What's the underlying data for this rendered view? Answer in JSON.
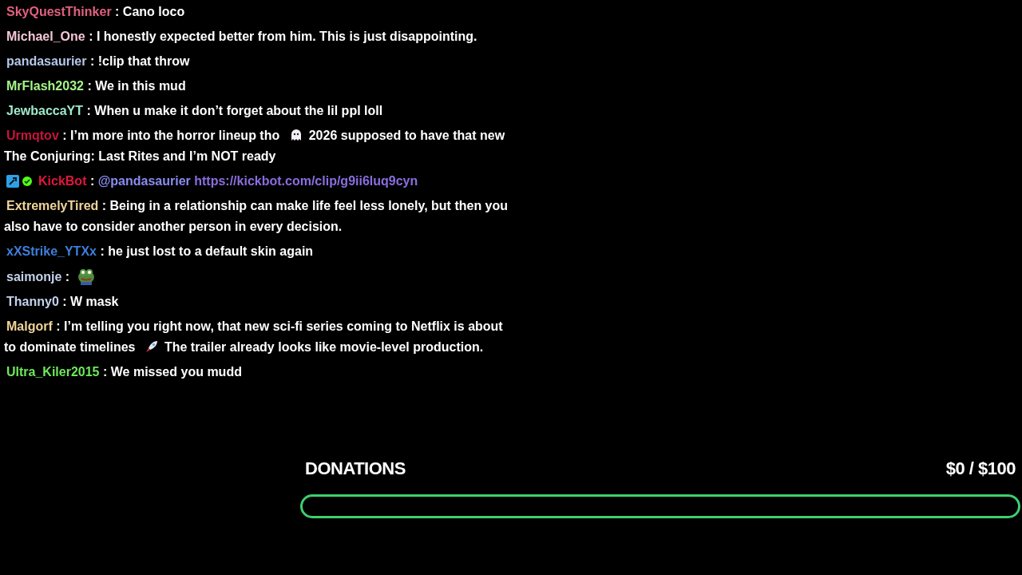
{
  "chat": [
    {
      "user": "SkyQuestThinker",
      "color": "#e0607e",
      "parts": [
        {
          "kind": "text",
          "text": ": Cano loco"
        }
      ]
    },
    {
      "user": "Michael_One",
      "color": "#f2c6d6",
      "parts": [
        {
          "kind": "text",
          "text": ": I honestly expected better from him. This is just disappointing."
        }
      ]
    },
    {
      "user": "pandasaurier",
      "color": "#b4c8ea",
      "parts": [
        {
          "kind": "text",
          "text": ": !clip that throw"
        }
      ]
    },
    {
      "user": "MrFlash2032",
      "color": "#a6f58a",
      "parts": [
        {
          "kind": "text",
          "text": ": We in this mud"
        }
      ]
    },
    {
      "user": "JewbaccaYT",
      "color": "#9fe8c8",
      "parts": [
        {
          "kind": "text",
          "text": ": When u make it don’t forget about the lil ppl loll"
        }
      ]
    },
    {
      "user": "Urmqtov",
      "color": "#c8143c",
      "parts": [
        {
          "kind": "text",
          "text": ": I’m more into the horror lineup tho"
        },
        {
          "kind": "ghost"
        },
        {
          "kind": "text",
          "text": "2026 supposed to have that new"
        },
        {
          "kind": "break"
        },
        {
          "kind": "text",
          "text": "The Conjuring: Last Rites and I’m NOT ready"
        }
      ]
    },
    {
      "user": "KickBot",
      "color": "#e0163c",
      "badges": [
        {
          "kind": "bot"
        },
        {
          "kind": "verified"
        }
      ],
      "parts": [
        {
          "kind": "text",
          "text": ":"
        },
        {
          "kind": "mention",
          "text": "@pandasaurier"
        },
        {
          "kind": "link",
          "text": "https://kickbot.com/clip/g9ii6luq9cyn"
        }
      ]
    },
    {
      "user": "ExtremelyTired",
      "color": "#f0d49a",
      "parts": [
        {
          "kind": "text",
          "text": ": Being in a relationship can make life feel less lonely, but then you"
        },
        {
          "kind": "break"
        },
        {
          "kind": "text",
          "text": "also have to consider another person in every decision."
        }
      ]
    },
    {
      "user": "xXStrike_YTXx",
      "color": "#3d7fdc",
      "parts": [
        {
          "kind": "text",
          "text": ": he just lost to a default skin again"
        }
      ]
    },
    {
      "user": "saimonje",
      "color": "#c4d2ec",
      "parts": [
        {
          "kind": "text",
          "text": ":"
        },
        {
          "kind": "frog"
        }
      ]
    },
    {
      "user": "Thanny0",
      "color": "#c4d2ec",
      "parts": [
        {
          "kind": "text",
          "text": ": W mask"
        }
      ]
    },
    {
      "user": "Malgorf",
      "color": "#f0d49a",
      "parts": [
        {
          "kind": "text",
          "text": ": I’m telling you right now, that new sci-fi series coming to Netflix is about"
        },
        {
          "kind": "break"
        },
        {
          "kind": "text",
          "text": "to dominate timelines"
        },
        {
          "kind": "rocket"
        },
        {
          "kind": "text",
          "text": "The trailer already looks like movie-level production."
        }
      ]
    },
    {
      "user": "Ultra_Kiler2015",
      "color": "#6ee85a",
      "parts": [
        {
          "kind": "text",
          "text": ": We missed you mudd"
        }
      ]
    }
  ],
  "goal": {
    "label": "DONATIONS",
    "amount": "$0 / $100",
    "level": 0
  }
}
